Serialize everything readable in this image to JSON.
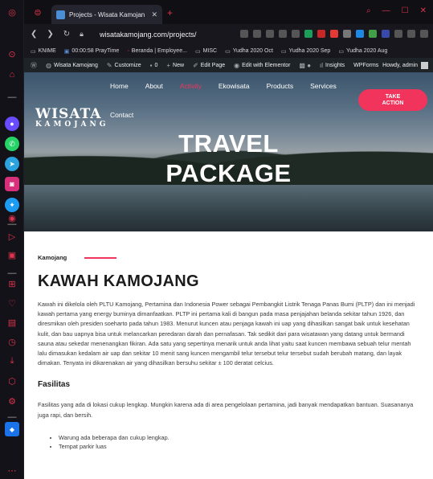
{
  "browser": {
    "tab_title": "Projects - Wisata Kamojan",
    "tab_close": "✕",
    "new_tab": "+",
    "url": "wisatakamojang.com/projects/",
    "bookmarks": [
      "KNIME",
      "00:00:58 PrayTime",
      "Beranda | Employee...",
      "MISC",
      "Yudha 2020 Oct",
      "Yudha 2020 Sep",
      "Yudha 2020 Aug"
    ]
  },
  "admin_bar": {
    "site": "Wisata Kamojang",
    "customize": "Customize",
    "comments": "0",
    "new": "New",
    "edit_page": "Edit Page",
    "elementor": "Edit with Elementor",
    "insights": "Insights",
    "wpforms": "WPForms",
    "howdy": "Howdy, admin"
  },
  "site": {
    "logo_top": "WISATA",
    "logo_bottom": "KAMOJANG",
    "menu": [
      "Home",
      "About",
      "Activity",
      "Ekowisata",
      "Products",
      "Services"
    ],
    "menu_contact": "Contact",
    "cta_line1": "TAKE",
    "cta_line2": "ACTION",
    "hero_line1": "TRAVEL",
    "hero_line2": "PACKAGE"
  },
  "article": {
    "breadcrumb": "Kamojang",
    "title": "KAWAH KAMOJANG",
    "intro": "Kawah ini dikelola oleh PLTU Kamojang, Pertamina dan Indonesia Power sebagai Pembangkit Listrik Tenaga Panas Bumi (PLTP) dan ini menjadi kawah pertama yang energy buminya dimanfaatkan. PLTP ini pertama kali di bangun pada masa penjajahan belanda sekitar tahun 1926, dan diresmikan oleh presiden soeharto pada tahun 1983. Menurut kuncen atau penjaga kawah ini uap yang dihasilkan sangat baik untuk kesehatan kulit, dan bau uapnya bisa untuk melancarkan peredaran darah dan pernafasan. Tak sedikit dari para wisatawan yang datang untuk bermandi sauna atau sekedar menenangkan fikiran. Ada satu yang sepertinya menarik untuk anda lihat yaitu saat kuncen membawa sebuah telur mentah lalu dimasukan kedalam air uap dan sekitar 10 menit sang kuncen mengambil telur tersebut telur tersebut sudah berubah matang, dan layak dimakan. Tenyata ini dikarenakan air yang dihasilkan bersuhu sekitar ± 100 deratat celcius.",
    "facilities_title": "Fasilitas",
    "facilities_text": "Fasilitas yang ada di lokasi cukup lengkap. Mungkin karena ada di area pengelolaan pertamina, jadi banyak mendapatkan bantuan. Suasananya juga rapi, dan bersih.",
    "facilities_list": [
      "Warung ada beberapa dan cukup lengkap.",
      "Tempat parkir luas"
    ]
  }
}
